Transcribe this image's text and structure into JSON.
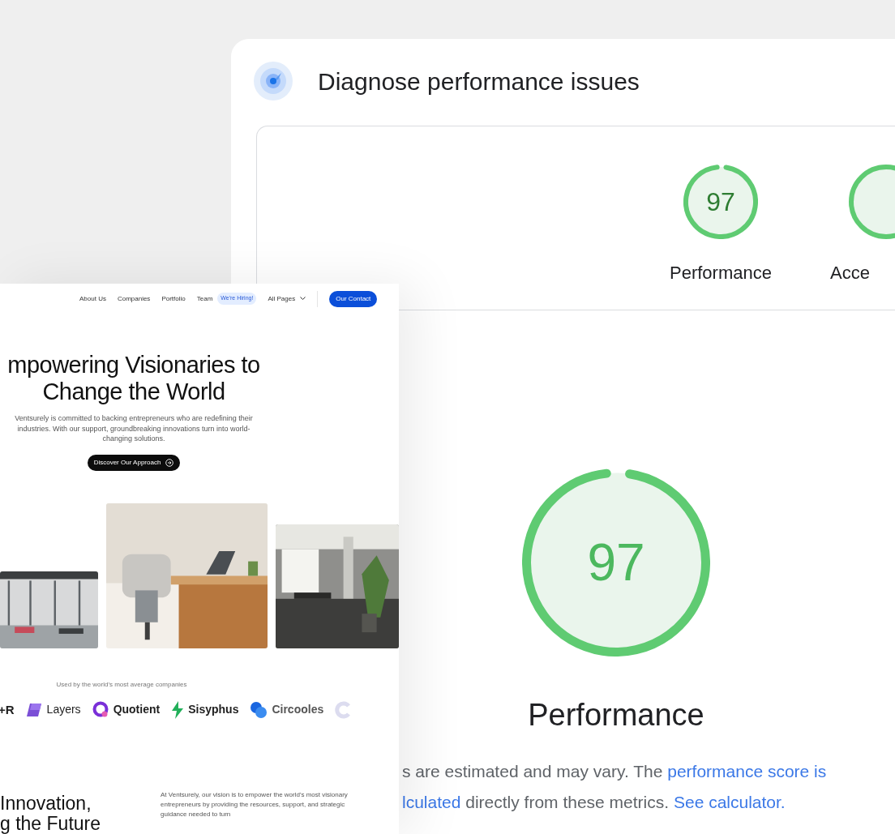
{
  "report": {
    "title": "Diagnose performance issues",
    "categories": [
      {
        "label": "Performance",
        "score": "97",
        "level": 0.97
      },
      {
        "label": "Acce"
      }
    ],
    "main_gauge": {
      "score": "97",
      "label": "Performance",
      "level": 0.97
    },
    "description": [
      [
        {
          "text": "s are estimated and may vary. The ",
          "link": false
        },
        {
          "text": "performance score is",
          "link": true
        }
      ],
      [
        {
          "text": "lculated",
          "link": true
        },
        {
          "text": " directly from these metrics. ",
          "link": false
        },
        {
          "text": "See calculator.",
          "link": true
        }
      ]
    ]
  },
  "website": {
    "nav": [
      {
        "label": "About Us",
        "kind": "link"
      },
      {
        "label": "Companies",
        "kind": "link"
      },
      {
        "label": "Portfolio",
        "kind": "link"
      },
      {
        "label": "Team",
        "kind": "link"
      },
      {
        "label": "We're Hiring!",
        "kind": "badge"
      },
      {
        "label": "All Pages",
        "kind": "dropdown"
      }
    ],
    "contact_button": "Our Contact",
    "hero": {
      "title_lines": [
        "mpowering Visionaries to",
        "Change the World"
      ],
      "text": "Ventsurely is committed to backing entrepreneurs who are redefining their industries. With our support, groundbreaking innovations turn into world-changing solutions.",
      "button": "Discover Our Approach"
    },
    "logos_caption": "Used by the world's most average companies",
    "logos": [
      {
        "name": "+R",
        "kind": "text"
      },
      {
        "name": "Layers",
        "kind": "layers"
      },
      {
        "name": "Quotient",
        "kind": "quotient"
      },
      {
        "name": "Sisyphus",
        "kind": "sisyphus"
      },
      {
        "name": "Circooles",
        "kind": "circooles"
      },
      {
        "kind": "faded"
      }
    ],
    "section": {
      "title_lines": [
        "Innovation,",
        "g the Future"
      ],
      "text": "At Ventsurely, our vision is to empower the world's most visionary entrepreneurs by providing the resources, support, and strategic guidance needed to turn"
    }
  }
}
